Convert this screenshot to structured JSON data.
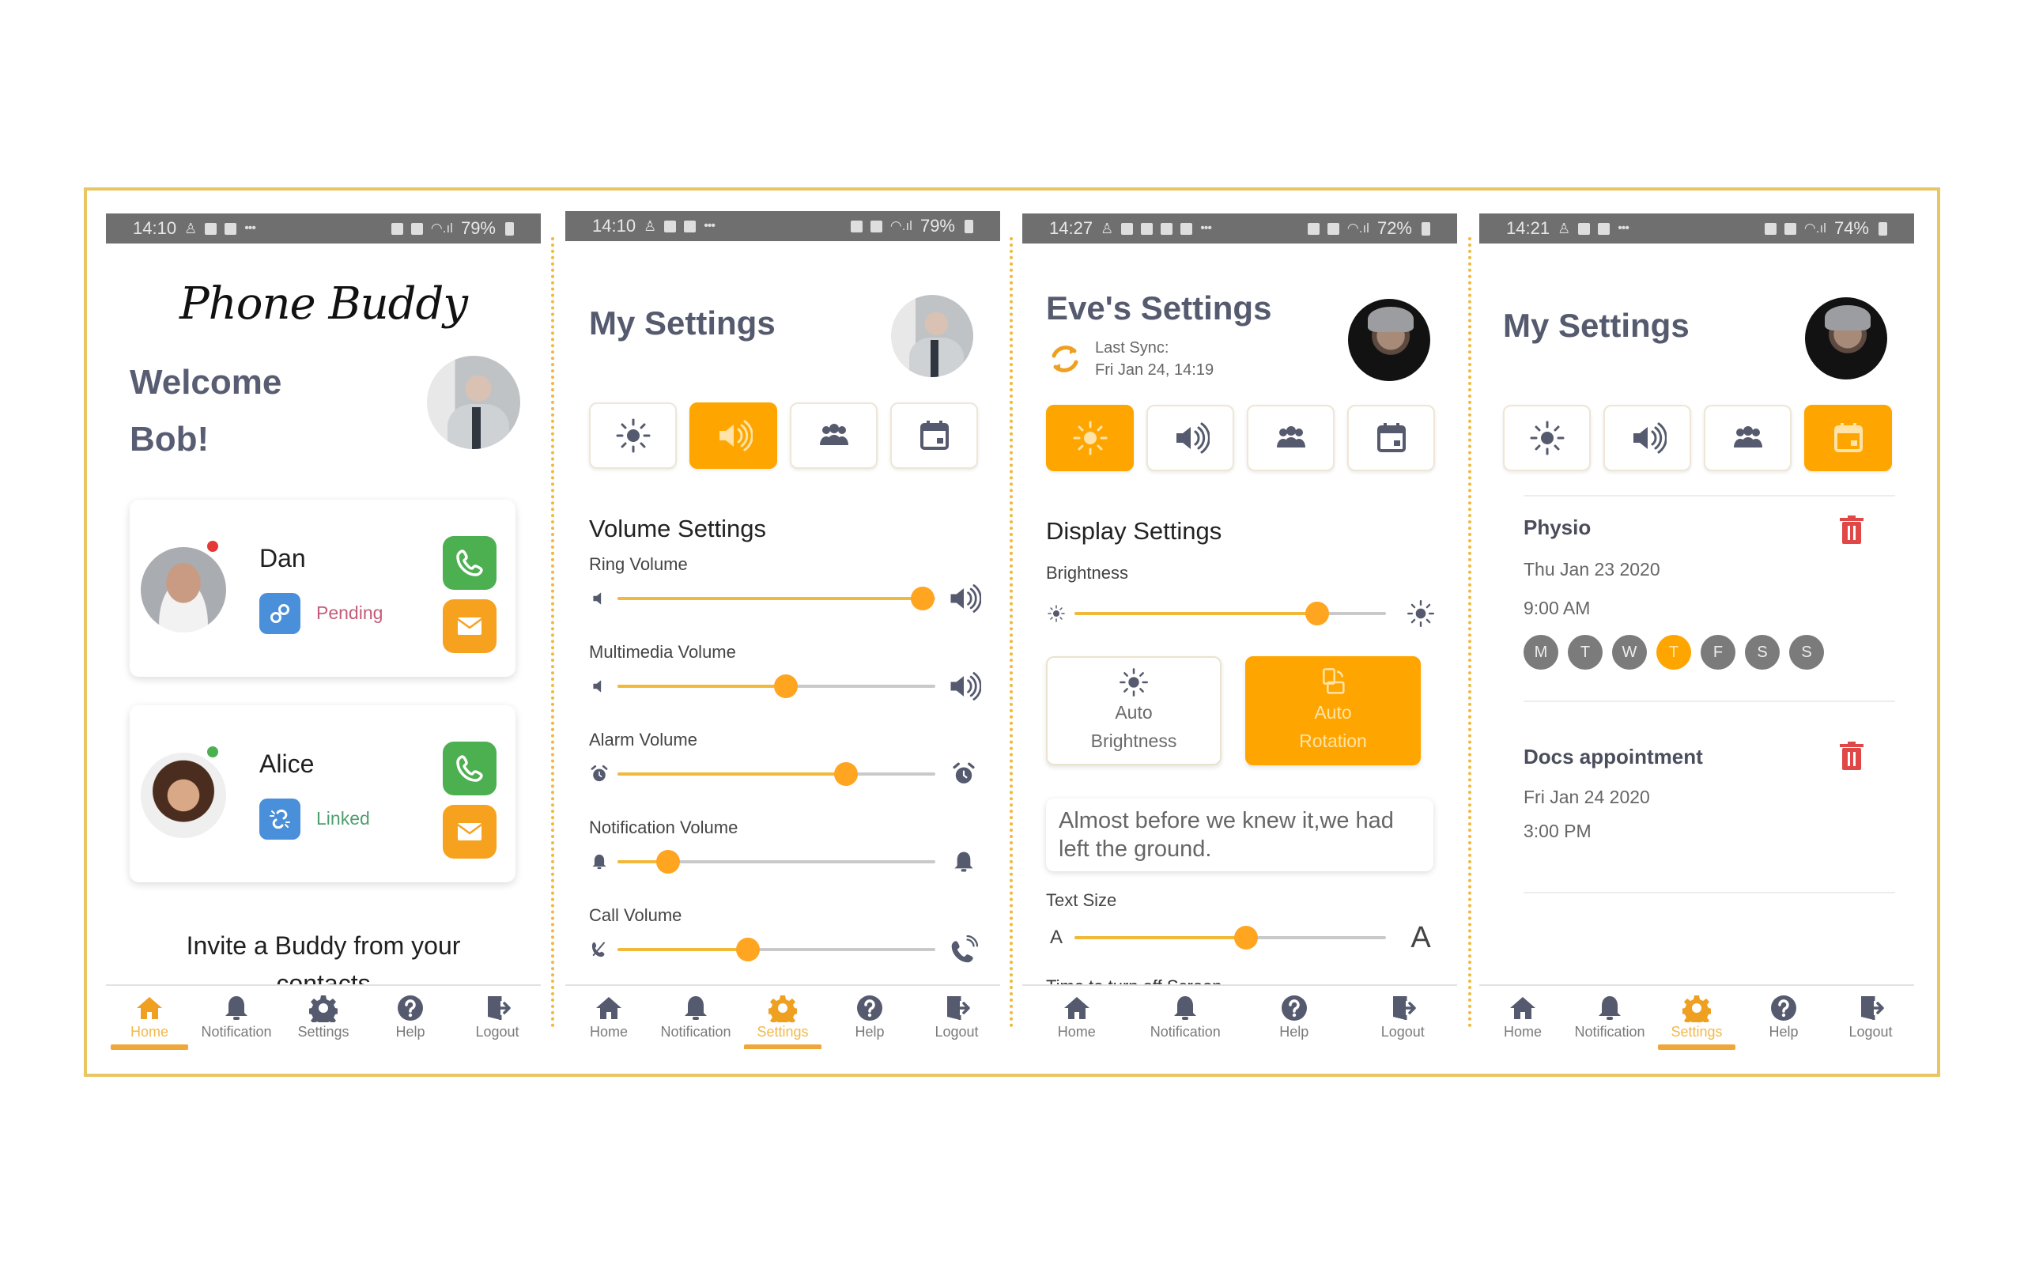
{
  "colors": {
    "accent": "#FFA500",
    "frame": "#E9C664",
    "call": "#4CAF50",
    "message": "#F7A21F",
    "link_badge": "#4A8FD9",
    "pending": "#C45B7A",
    "linked": "#4E9F70",
    "delete": "#E04848",
    "icon": "#555a6e"
  },
  "nav_labels": {
    "home": "Home",
    "notification": "Notification",
    "settings": "Settings",
    "help": "Help",
    "logout": "Logout"
  },
  "screens": [
    {
      "status": {
        "time": "14:10",
        "battery": "79%"
      },
      "logo": "Phone Buddy",
      "welcome_line1": "Welcome",
      "welcome_line2": "Bob!",
      "buddies": [
        {
          "name": "Dan",
          "status": "Pending",
          "online": false
        },
        {
          "name": "Alice",
          "status": "Linked",
          "online": true
        }
      ],
      "invite_line1": "Invite a Buddy from your",
      "invite_line2": "contacts",
      "active_nav": "home"
    },
    {
      "status": {
        "time": "14:10",
        "battery": "79%"
      },
      "title": "My Settings",
      "active_tab": "volume",
      "section_title": "Volume Settings",
      "sliders": [
        {
          "label": "Ring Volume",
          "value": 0.96,
          "min_icon": "speaker-low-icon",
          "max_icon": "speaker-high-icon"
        },
        {
          "label": "Multimedia Volume",
          "value": 0.53,
          "min_icon": "speaker-low-icon",
          "max_icon": "speaker-high-icon"
        },
        {
          "label": "Alarm Volume",
          "value": 0.72,
          "min_icon": "alarm-clock-icon",
          "max_icon": "alarm-ringing-icon"
        },
        {
          "label": "Notification Volume",
          "value": 0.16,
          "min_icon": "bell-icon",
          "max_icon": "bell-ringing-icon"
        },
        {
          "label": "Call Volume",
          "value": 0.41,
          "min_icon": "phone-muted-icon",
          "max_icon": "phone-ringing-icon"
        }
      ],
      "active_nav": "settings"
    },
    {
      "status": {
        "time": "14:27",
        "battery": "72%"
      },
      "title": "Eve's Settings",
      "sync_label": "Last Sync:",
      "sync_time": "Fri Jan 24, 14:19",
      "active_tab": "display",
      "section_title": "Display Settings",
      "brightness_label": "Brightness",
      "brightness_value": 0.78,
      "auto_brightness": {
        "line1": "Auto",
        "line2": "Brightness",
        "on": false
      },
      "auto_rotation": {
        "line1": "Auto",
        "line2": "Rotation",
        "on": true
      },
      "sample_text": "Almost before we knew it,we had left the ground.",
      "text_size_label": "Text Size",
      "text_size_min": "A",
      "text_size_max": "A",
      "text_size_value": 0.55,
      "cutoff_label": "Time to turn off Screen",
      "active_nav": "settings"
    },
    {
      "status": {
        "time": "14:21",
        "battery": "74%"
      },
      "title": "My Settings",
      "active_tab": "calendar",
      "appointments": [
        {
          "title": "Physio",
          "date": "Thu Jan 23 2020",
          "time": "9:00 AM",
          "days": [
            {
              "label": "M",
              "on": false
            },
            {
              "label": "T",
              "on": false
            },
            {
              "label": "W",
              "on": false
            },
            {
              "label": "T",
              "on": true
            },
            {
              "label": "F",
              "on": false
            },
            {
              "label": "S",
              "on": false
            },
            {
              "label": "S",
              "on": false
            }
          ]
        },
        {
          "title": "Docs appointment",
          "date": "Fri Jan 24 2020",
          "time": "3:00 PM"
        }
      ],
      "active_nav": "settings"
    }
  ]
}
